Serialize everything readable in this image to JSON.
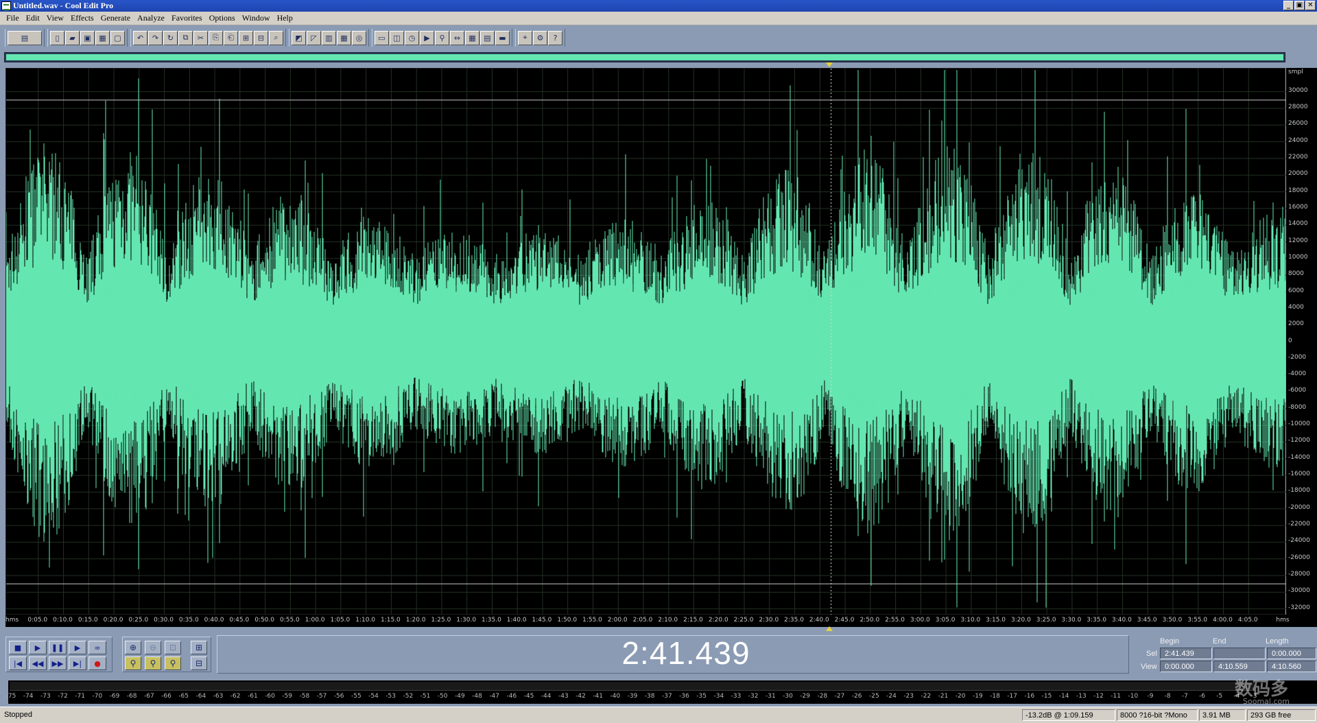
{
  "window": {
    "title": "Untitled.wav - Cool Edit Pro",
    "min": "_",
    "max": "▣",
    "close": "✕"
  },
  "menu": [
    "File",
    "Edit",
    "View",
    "Effects",
    "Generate",
    "Analyze",
    "Favorites",
    "Options",
    "Window",
    "Help"
  ],
  "toolbar": {
    "groups": [
      [
        "waveform-multitrack-toggle-icon"
      ],
      [
        "new-file-icon",
        "open-file-icon",
        "save-icon",
        "save-as-icon",
        "close-file-icon"
      ],
      [
        "undo-icon",
        "redo-icon",
        "repeat-icon",
        "copy-icon",
        "cut-icon",
        "paste-icon",
        "paste-new-icon",
        "mix-paste-icon",
        "trim-icon",
        "analyze-icon"
      ],
      [
        "envelope-icon",
        "frequency-icon",
        "spectral-icon",
        "spectral-pan-icon",
        "cd-icon"
      ],
      [
        "frame-icon",
        "metronome-icon",
        "time-icon",
        "play-icon",
        "zoom-selection-icon",
        "scroll-icon",
        "keyboard-icon",
        "midi-icon",
        "cue-list-icon"
      ],
      [
        "snap-icon",
        "settings-icon",
        "help-icon"
      ]
    ]
  },
  "waveform": {
    "color": "#63e6b0",
    "grid_color": "#2a3a2a",
    "y_unit": "smpl",
    "y_ticks": [
      "30000",
      "28000",
      "26000",
      "24000",
      "22000",
      "20000",
      "18000",
      "16000",
      "14000",
      "12000",
      "10000",
      "8000",
      "6000",
      "4000",
      "2000",
      "0",
      "-2000",
      "-4000",
      "-6000",
      "-8000",
      "-10000",
      "-12000",
      "-14000",
      "-16000",
      "-18000",
      "-20000",
      "-22000",
      "-24000",
      "-26000",
      "-28000",
      "-30000",
      "-32000"
    ],
    "x_start_label": "hms",
    "x_end_label": "hms",
    "x_ticks": [
      "0:05.0",
      "0:10.0",
      "0:15.0",
      "0:20.0",
      "0:25.0",
      "0:30.0",
      "0:35.0",
      "0:40.0",
      "0:45.0",
      "0:50.0",
      "0:55.0",
      "1:00.0",
      "1:05.0",
      "1:10.0",
      "1:15.0",
      "1:20.0",
      "1:25.0",
      "1:30.0",
      "1:35.0",
      "1:40.0",
      "1:45.0",
      "1:50.0",
      "1:55.0",
      "2:00.0",
      "2:05.0",
      "2:10.0",
      "2:15.0",
      "2:20.0",
      "2:25.0",
      "2:30.0",
      "2:35.0",
      "2:40.0",
      "2:45.0",
      "2:50.0",
      "2:55.0",
      "3:00.0",
      "3:05.0",
      "3:10.0",
      "3:15.0",
      "3:20.0",
      "3:25.0",
      "3:30.0",
      "3:35.0",
      "3:40.0",
      "3:45.0",
      "3:50.0",
      "3:55.0",
      "4:00.0",
      "4:05.0"
    ],
    "cursor_time_fraction": 0.6445
  },
  "transport": {
    "buttons_row1": [
      {
        "name": "stop-button",
        "glyph": "■"
      },
      {
        "name": "play-button",
        "glyph": "▶"
      },
      {
        "name": "pause-button",
        "glyph": "❚❚"
      },
      {
        "name": "play-to-end-button",
        "glyph": "▶"
      },
      {
        "name": "loop-button",
        "glyph": "∞"
      }
    ],
    "buttons_row2": [
      {
        "name": "go-to-start-button",
        "glyph": "|◀"
      },
      {
        "name": "rewind-button",
        "glyph": "◀◀"
      },
      {
        "name": "fast-forward-button",
        "glyph": "▶▶"
      },
      {
        "name": "go-to-end-button",
        "glyph": "▶|"
      },
      {
        "name": "record-button",
        "glyph": "●"
      }
    ],
    "time_display": "2:41.439"
  },
  "selection": {
    "headers": {
      "begin": "Begin",
      "end": "End",
      "length": "Length"
    },
    "sel_label": "Sel",
    "view_label": "View",
    "sel": {
      "begin": "2:41.439",
      "end": "",
      "length": "0:00.000"
    },
    "view": {
      "begin": "0:00.000",
      "end": "4:10.559",
      "length": "4:10.560"
    }
  },
  "meter": {
    "labels": [
      "-75",
      "-74",
      "-73",
      "-72",
      "-71",
      "-70",
      "-69",
      "-68",
      "-67",
      "-66",
      "-65",
      "-64",
      "-63",
      "-62",
      "-61",
      "-60",
      "-59",
      "-58",
      "-57",
      "-56",
      "-55",
      "-54",
      "-53",
      "-52",
      "-51",
      "-50",
      "-49",
      "-48",
      "-47",
      "-46",
      "-45",
      "-44",
      "-43",
      "-42",
      "-41",
      "-40",
      "-39",
      "-38",
      "-37",
      "-36",
      "-35",
      "-34",
      "-33",
      "-32",
      "-31",
      "-30",
      "-29",
      "-28",
      "-27",
      "-26",
      "-25",
      "-24",
      "-23",
      "-22",
      "-21",
      "-20",
      "-19",
      "-18",
      "-17",
      "-16",
      "-15",
      "-14",
      "-13",
      "-12",
      "-11",
      "-10",
      "-9",
      "-8",
      "-7",
      "-6",
      "-5",
      "-4",
      "-3"
    ]
  },
  "status": {
    "state": "Stopped",
    "level": "-13.2dB @  1:09.159",
    "format": "8000 ?16-bit ?Mono",
    "size": "3.91 MB",
    "free": "293 GB free"
  },
  "watermark": {
    "main": "数码多",
    "sub": "Soomal.com"
  }
}
